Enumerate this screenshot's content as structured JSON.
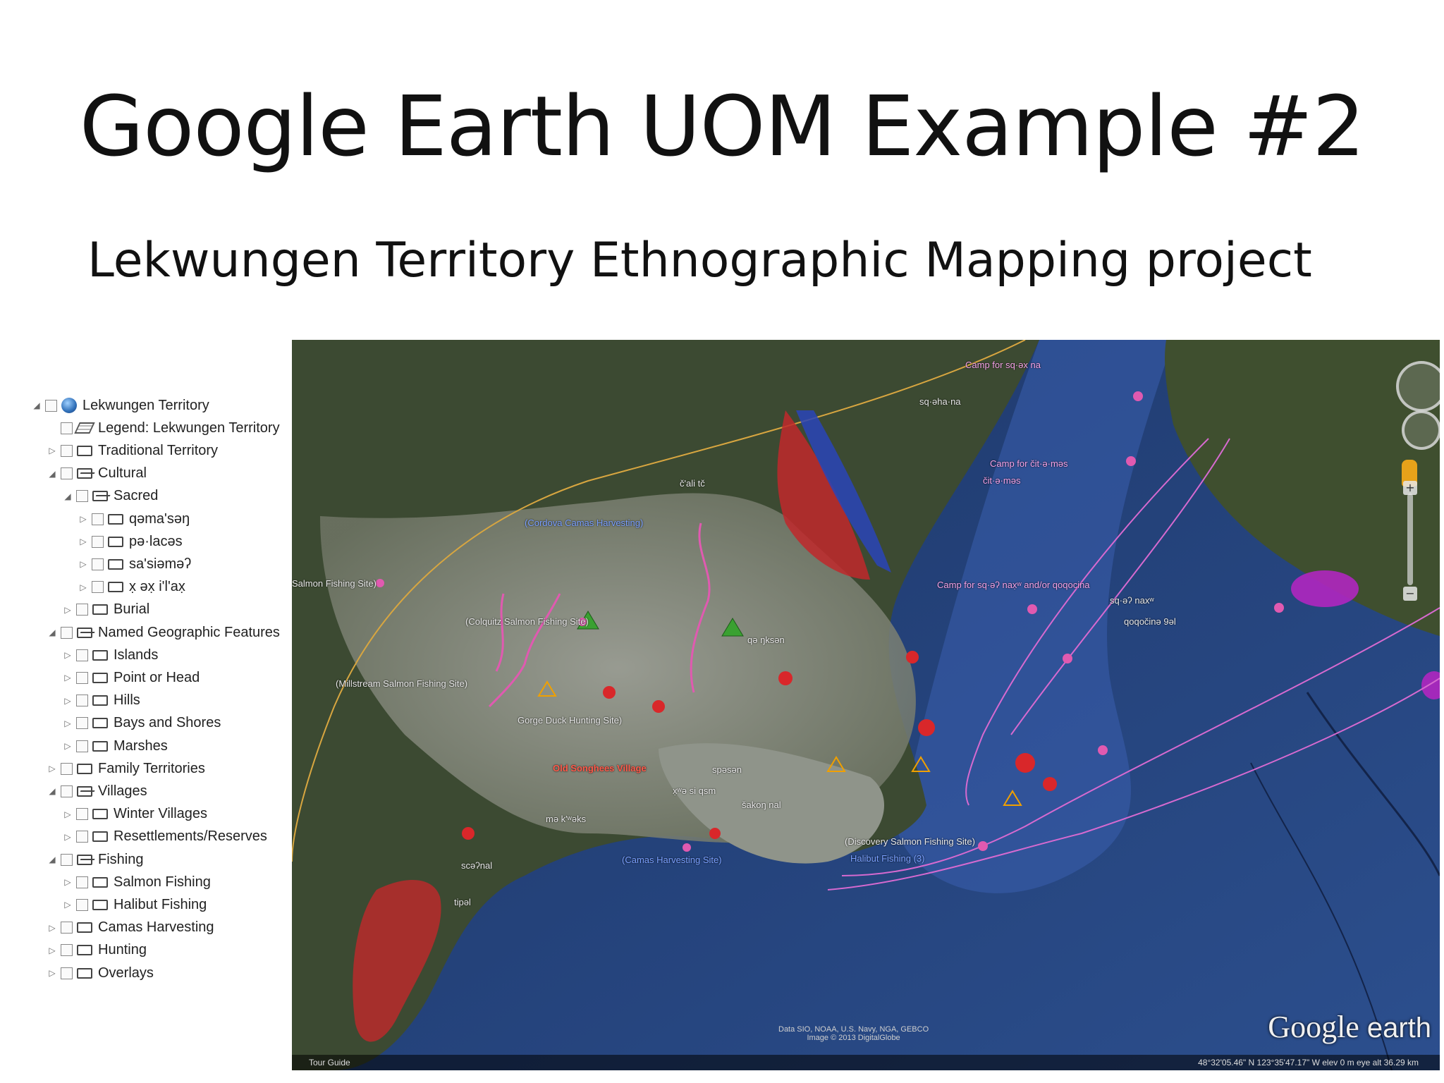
{
  "slide": {
    "title": "Google Earth UOM Example #2",
    "subtitle": "Lekwungen Territory Ethnographic Mapping project"
  },
  "tree": {
    "items": [
      {
        "label": "Lekwungen Territory",
        "icon": "globe-icon"
      },
      {
        "label": "Legend: Lekwungen Territory",
        "icon": "legend-icon"
      },
      {
        "label": "Traditional Territory",
        "icon": "folder-icon"
      },
      {
        "label": "Cultural",
        "icon": "folder-open-icon"
      },
      {
        "label": "Sacred",
        "icon": "folder-open-icon"
      },
      {
        "label": "qəma'səŋ",
        "icon": "folder-icon"
      },
      {
        "label": "pə·lacəs",
        "icon": "folder-icon"
      },
      {
        "label": "sa'siəməʔ",
        "icon": "folder-icon"
      },
      {
        "label": "x̣ əx̣ i'l'ax̣",
        "icon": "folder-icon"
      },
      {
        "label": "Burial",
        "icon": "folder-icon"
      },
      {
        "label": "Named Geographic Features",
        "icon": "folder-open-icon"
      },
      {
        "label": "Islands",
        "icon": "folder-icon"
      },
      {
        "label": "Point or Head",
        "icon": "folder-icon"
      },
      {
        "label": "Hills",
        "icon": "folder-icon"
      },
      {
        "label": "Bays and Shores",
        "icon": "folder-icon"
      },
      {
        "label": "Marshes",
        "icon": "folder-icon"
      },
      {
        "label": "Family Territories",
        "icon": "folder-icon"
      },
      {
        "label": "Villages",
        "icon": "folder-open-icon"
      },
      {
        "label": "Winter Villages",
        "icon": "folder-icon"
      },
      {
        "label": "Resettlements/Reserves",
        "icon": "folder-icon"
      },
      {
        "label": "Fishing",
        "icon": "folder-open-icon"
      },
      {
        "label": "Salmon Fishing",
        "icon": "folder-icon"
      },
      {
        "label": "Halibut Fishing",
        "icon": "folder-icon"
      },
      {
        "label": "Camas Harvesting",
        "icon": "folder-icon"
      },
      {
        "label": "Hunting",
        "icon": "folder-icon"
      },
      {
        "label": "Overlays",
        "icon": "folder-icon"
      }
    ]
  },
  "map": {
    "labels": {
      "camp_tenbos": "Camp for sq·əx na",
      "sqeha_na": "sq·əha·na",
      "camp_cit_mas": "Camp for čit·ə·məs",
      "cit_mas": "čit·ə·məs",
      "camp_shang": "Camp for sq·əʔ nax̣ʷ and/or qoqocina",
      "sqenaxw": "sq·əʔ naxʷ",
      "qoqocina": "qoqočinə 9əl",
      "salmon_fishing_left": "Salmon Fishing Site)",
      "cordova": "(Cordova Camas Harvesting)",
      "colquitz": "(Colquitz Salmon Fishing Site)",
      "millstream": "(Millstream Salmon Fishing Site)",
      "gorge": "Gorge Duck Hunting Site)",
      "discovery": "(Discovery Salmon Fishing Site)",
      "halibut": "Halibut Fishing (3)",
      "camas_harvest": "(Camas Harvesting Site)",
      "cali_tc": "č'ali tč",
      "qa_ksan": "qə ŋksən",
      "sakonal": "šakoŋ nal",
      "spson": "spəsən",
      "scinal": "scəʔnal",
      "tipal": "tipəl",
      "makwaks": "mə k'ʷəks",
      "xasiqsm": "x̣ʷə si qsm",
      "songhees": "Old Songhees Village"
    },
    "logo_main": "Google",
    "logo_sub": "earth",
    "credits_line1": "Data SIO, NOAA, U.S. Navy, NGA, GEBCO",
    "credits_line2": "Image © 2013 DigitalGlobe",
    "tour_label": "Tour Guide",
    "coords": "48°32'05.46\" N  123°35'47.17\" W  elev   0 m     eye alt  36.29 km"
  }
}
